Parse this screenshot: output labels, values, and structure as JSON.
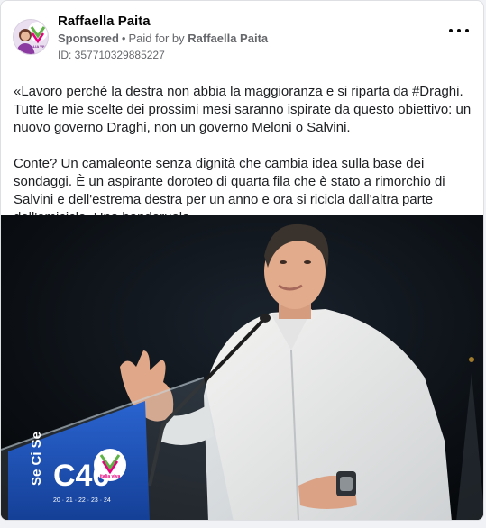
{
  "post": {
    "author": "Raffaella Paita",
    "sponsored_label": "Sponsored",
    "separator": "•",
    "paid_for_prefix": "Paid for by",
    "paid_for_name": "Raffaella Paita",
    "id_line": "ID: 357710329885227",
    "body": [
      "«Lavoro perché la destra non abbia la maggioranza e si riparta da #Draghi. Tutte le mie scelte dei prossimi mesi saranno ispirate da questo obiettivo: un nuovo governo Draghi, non un governo Meloni o Salvini.",
      "Conte? Un camaleonte senza dignità che cambia idea sulla base dei sondaggi. È un aspirante doroteo di quarta fila che è stato a rimorchio di Salvini e dell'estrema destra per un anno e ora si ricicla dall'altra parte dell'emiciclo. Una banderuola…"
    ],
    "avatar_text": "ITALIA VIVA",
    "image": {
      "podium_text": "C46",
      "podium_side_text": "Se Ci Se",
      "podium_logo_text": "italia viva",
      "podium_small_text": "20 · 21 · 22 · 23 · 24"
    }
  },
  "colors": {
    "author": "#050505",
    "meta": "#65676b",
    "body_text": "#1c1e21",
    "podium_blue": "#1a4fb4",
    "logo_pink": "#e6007e"
  }
}
